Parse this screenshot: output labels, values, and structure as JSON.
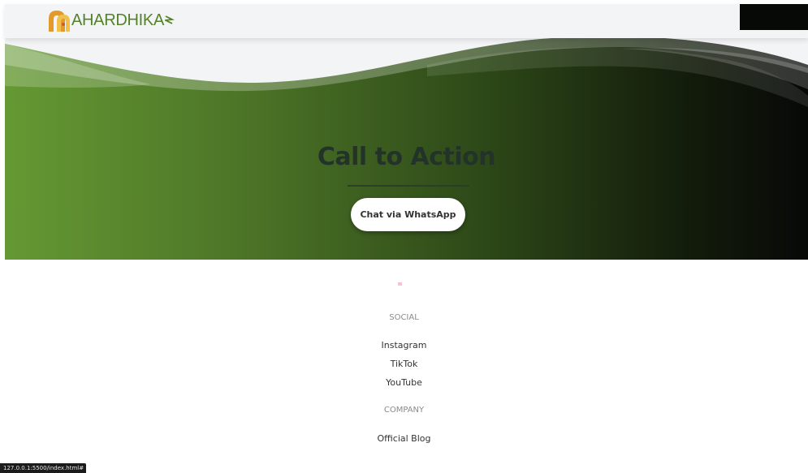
{
  "header": {
    "logo_text": "AHARDHIKA"
  },
  "hero": {
    "title": "Call to Action",
    "cta_label": "Chat via WhatsApp"
  },
  "footer": {
    "social_heading": "SOCIAL",
    "social_links": [
      "Instagram",
      "TikTok",
      "YouTube"
    ],
    "company_heading": "COMPANY",
    "company_links": [
      "Official Blog"
    ]
  },
  "status_bar": {
    "url": "127.0.0.1:5500/index.html#"
  },
  "colors": {
    "brand_green": "#55812b",
    "hero_start": "#659933",
    "hero_end": "#070907",
    "title_dark": "#24332a"
  }
}
